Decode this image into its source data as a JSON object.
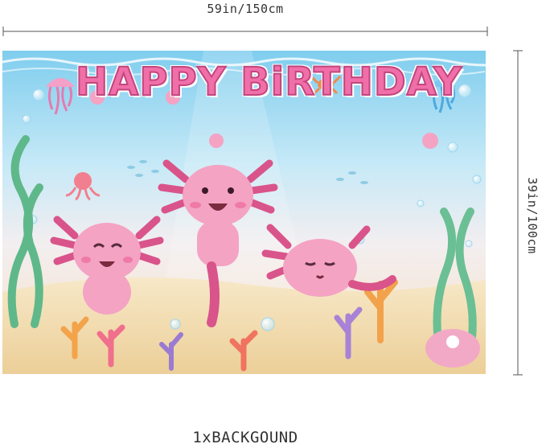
{
  "dimensions": {
    "width_label": "59in/150cm",
    "height_label": "39in/100cm"
  },
  "banner": {
    "title": "HAPPY BiRTHDAY"
  },
  "caption": "1xBACKGOUND",
  "colors": {
    "title_fill": "#f06fa8",
    "axolotl_pink": "#f4a3c3",
    "water_top": "#8fd3f0",
    "sand": "#f3e0b6"
  }
}
